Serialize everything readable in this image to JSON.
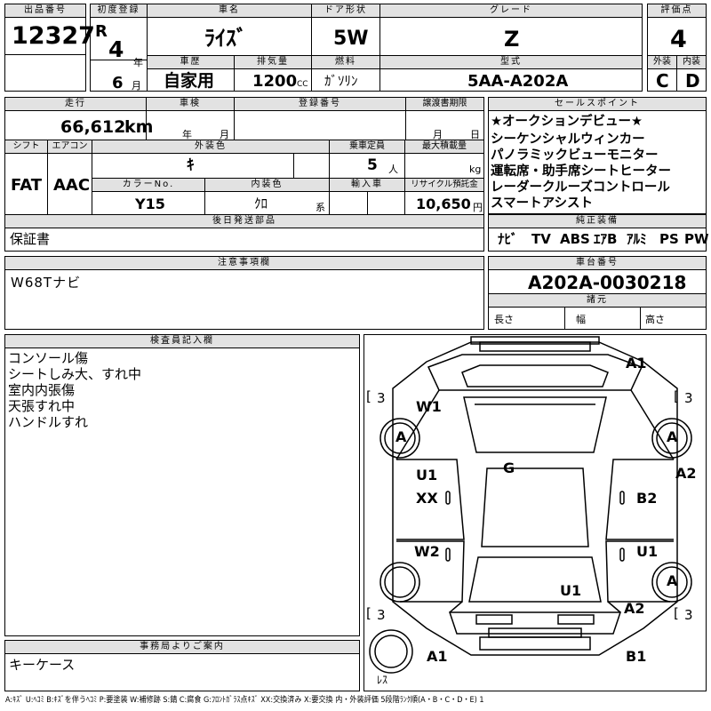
{
  "labels": {
    "lot_no": "出品番号",
    "first_reg": "初度登録",
    "car_name": "車名",
    "door": "ドア形状",
    "grade": "グレード",
    "score": "評価点",
    "history": "車歴",
    "displacement": "排気量",
    "fuel": "燃料",
    "model_type": "型式",
    "exterior": "外装",
    "interior": "内装",
    "mileage": "走行",
    "inspection": "車検",
    "reg_no": "登録番号",
    "transfer": "譲渡書期限",
    "sales_points": "セールスポイント",
    "shift": "シフト",
    "aircon": "エアコン",
    "ext_color": "外装色",
    "capacity": "乗車定員",
    "max_load": "最大積載量",
    "color_no": "カラーNo.",
    "int_color": "内装色",
    "import": "輸入車",
    "recycle": "リサイクル預託金",
    "later_parts": "後日発送部品",
    "standard_equip": "純正装備",
    "notes_header": "注意事項欄",
    "chassis_header": "車台番号",
    "specs_header": "諸元",
    "length": "長さ",
    "width": "幅",
    "height": "高さ",
    "inspector_header": "検査員記入欄",
    "office_header": "事務局よりご案内"
  },
  "units": {
    "reiwa": "R",
    "year": "年",
    "month": "月",
    "cc": "CC",
    "km": "km",
    "persons": "人",
    "kg": "kg",
    "kei": "系",
    "yen": "円"
  },
  "values": {
    "lot_no": "12327",
    "year": "4",
    "month": "6",
    "car_name": "ﾗｲｽﾞ",
    "door": "5W",
    "grade": "Z",
    "score": "4",
    "history": "自家用",
    "displacement": "1200",
    "fuel": "ｶﾞｿﾘﾝ",
    "model_type": "5AA-A202A",
    "exterior_grade": "C",
    "interior_grade": "D",
    "mileage": "66,612",
    "shift": "FAT",
    "aircon": "AAC",
    "ext_color": "ｷ",
    "capacity": "5",
    "color_no": "Y15",
    "int_color": "ｸﾛ",
    "recycle": "10,650",
    "later_parts": "保証書",
    "notes": "W68Tナビ",
    "chassis_no": "A202A-0030218",
    "office_note": "キーケース"
  },
  "sales_points": [
    "★オークションデビュー★",
    "シーケンシャルウィンカー",
    "パノラミックビューモニター",
    "運転席・助手席シートヒーター",
    "レーダークルーズコントロール",
    "スマートアシスト"
  ],
  "equipment": [
    "ﾅﾋﾞ",
    "TV",
    "ABS",
    "ｴｱB",
    "ｱﾙﾐ",
    "PS",
    "PW"
  ],
  "inspector_notes": [
    "コンソール傷",
    "シートしみ大、すれ中",
    "室内内張傷",
    "天張すれ中",
    "ハンドルすれ"
  ],
  "diagram": {
    "tire_fl": "3",
    "tire_fr": "3",
    "tire_rl": "3",
    "tire_rr": "3",
    "A1_front": "A1",
    "W1": "W1",
    "A_left_front": "A",
    "A_right_front": "A",
    "A2_right": "A2",
    "U1_left": "U1",
    "XX_left": "XX",
    "G": "G",
    "B2_right": "B2",
    "W2_left": "W2",
    "U1_right": "U1",
    "A_right_rear": "A",
    "U1_rear": "U1",
    "A2_rear": "A2",
    "A1_rear": "A1",
    "B1_rear": "B1",
    "spare": "ﾚｽ",
    "bracket": "["
  },
  "legend": "A:ｷｽﾞ U:ﾍｺﾐ B:ｷｽﾞを伴うﾍｺﾐ P:要塗装 W:補修跡 S:錆 C:腐食 G:ﾌﾛﾝﾄｶﾞﾗｽ点ｷｽﾞ XX:交換済み X:要交換 内・外装評価 5段階ﾗﾝｸ順(A・B・C・D・E) 1"
}
